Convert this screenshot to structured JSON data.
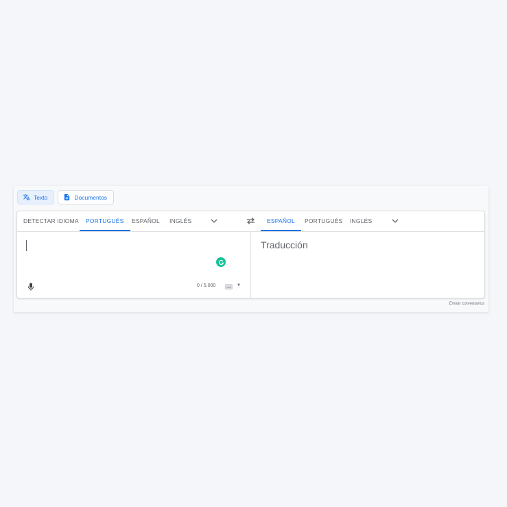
{
  "modes": [
    {
      "label": "Texto",
      "icon": "translate-icon",
      "active": true
    },
    {
      "label": "Documentos",
      "icon": "document-icon",
      "active": false
    }
  ],
  "source": {
    "languages": [
      "DETECTAR IDIOMA",
      "PORTUGUÉS",
      "ESPAÑOL",
      "INGLÉS"
    ],
    "active_index": 1,
    "input_value": "",
    "char_count": "0 / 5.000"
  },
  "target": {
    "languages": [
      "ESPAÑOL",
      "PORTUGUÉS",
      "INGLÉS"
    ],
    "active_index": 0,
    "placeholder": "Traducción"
  },
  "feedback_link": "Enviar comentarios",
  "colors": {
    "accent": "#1a73e8",
    "grammarly": "#15c39a"
  }
}
